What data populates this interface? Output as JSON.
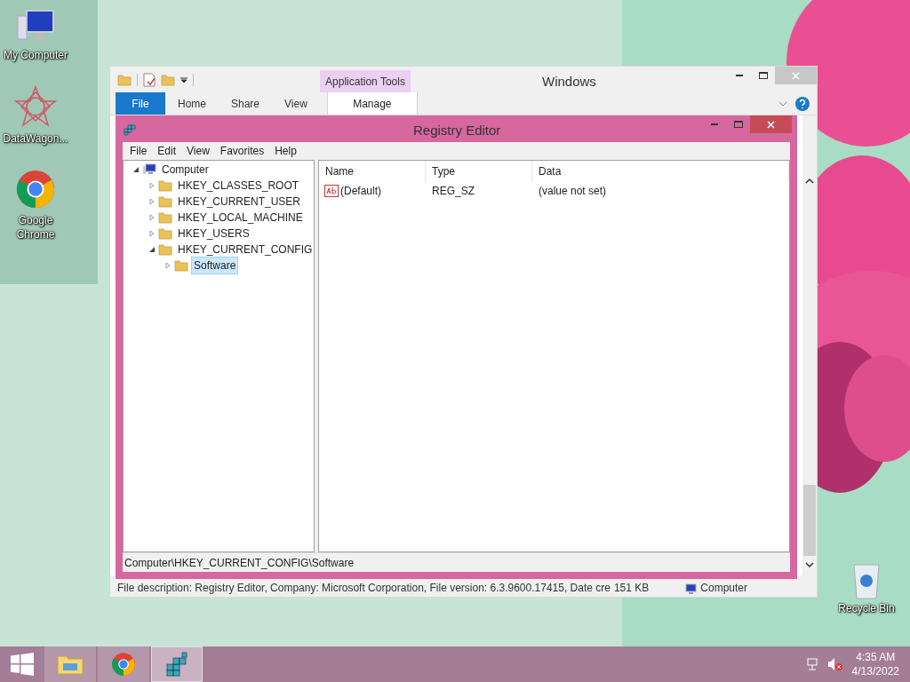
{
  "desktop_icons": [
    {
      "kind": "computer",
      "label": "My Computer"
    },
    {
      "kind": "star",
      "label": "DataWagon..."
    },
    {
      "kind": "chrome",
      "label": "Google Chrome"
    }
  ],
  "recycle_bin": {
    "label": "Recycle Bin"
  },
  "explorer": {
    "title": "Windows",
    "contextual_group": "Application Tools",
    "tabs": [
      {
        "kind": "file",
        "label": "File"
      },
      {
        "kind": "plain",
        "label": "Home"
      },
      {
        "kind": "plain",
        "label": "Share"
      },
      {
        "kind": "plain",
        "label": "View"
      },
      {
        "kind": "context",
        "label": "Manage"
      }
    ],
    "status_text": "File description: Registry Editor, Company: Microsoft Corporation, File version: 6.3.9600.17415, Date cre",
    "status_size": "151 KB",
    "status_location": "Computer"
  },
  "registry": {
    "title": "Registry Editor",
    "menu": [
      "File",
      "Edit",
      "View",
      "Favorites",
      "Help"
    ],
    "tree": {
      "label": "Computer",
      "expanded": true,
      "selected": false,
      "children": [
        {
          "label": "HKEY_CLASSES_ROOT",
          "expanded": false,
          "selected": false
        },
        {
          "label": "HKEY_CURRENT_USER",
          "expanded": false,
          "selected": false
        },
        {
          "label": "HKEY_LOCAL_MACHINE",
          "expanded": false,
          "selected": false
        },
        {
          "label": "HKEY_USERS",
          "expanded": false,
          "selected": false
        },
        {
          "label": "HKEY_CURRENT_CONFIG",
          "expanded": true,
          "selected": false,
          "children": [
            {
              "label": "Software",
              "expanded": false,
              "selected": true
            }
          ]
        }
      ]
    },
    "columns": [
      "Name",
      "Type",
      "Data"
    ],
    "rows": [
      {
        "name": "(Default)",
        "type": "REG_SZ",
        "data": "(value not set)"
      }
    ],
    "status": "Computer\\HKEY_CURRENT_CONFIG\\Software"
  },
  "taskbar": {
    "apps": [
      {
        "kind": "explorer",
        "selected": false
      },
      {
        "kind": "chrome",
        "selected": false
      },
      {
        "kind": "regedit",
        "selected": true
      }
    ],
    "time": "4:35 AM",
    "date": "4/13/2022"
  }
}
